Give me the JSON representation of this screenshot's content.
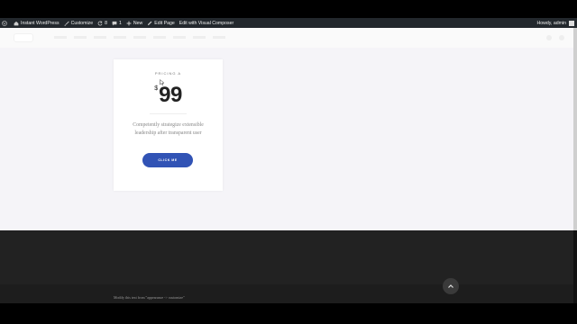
{
  "admin_bar": {
    "site_name": "Instant WordPress",
    "customize": "Customize",
    "updates_count": "8",
    "comments_count": "1",
    "new_label": "New",
    "edit_page": "Edit Page",
    "visual_composer": "Edit with Visual Composer",
    "greeting": "Howdy, admin",
    "icons": [
      "wordpress-icon",
      "home-icon",
      "brush-icon",
      "refresh-icon",
      "comment-icon",
      "plus-icon",
      "pencil-icon"
    ]
  },
  "pricing": {
    "label": "PRICING A",
    "currency": "$",
    "amount": "99",
    "description": "Competently strategize extensible leadership after transparent user",
    "button_label": "CLICK ME",
    "accent": "#3153b5"
  },
  "footer": {
    "text": "Modify this text from \"appearance -> customize\"",
    "totop_icon": "chevron-up-icon"
  },
  "colors": {
    "admin_bar": "#23282d",
    "page_bg": "#f5f4f8",
    "footer_bg": "#222222"
  }
}
